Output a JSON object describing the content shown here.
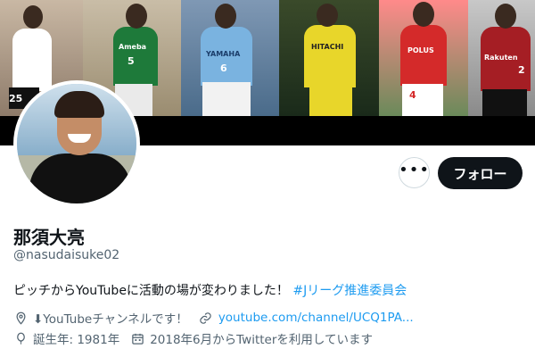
{
  "profile": {
    "display_name": "那須大亮",
    "handle": "@nasudaisuke02",
    "bio_text": "ピッチからYouTubeに活動の場が変わりました！",
    "bio_hashtag": "#Jリーグ推進委員会",
    "location": "⬇YouTubeチャンネルです！",
    "website": "youtube.com/channel/UCQ1PA...",
    "birth": "誕生年: 1981年",
    "joined": "2018年6月からTwitterを利用しています"
  },
  "actions": {
    "more_label": "•••",
    "follow_label": "フォロー"
  },
  "banner": {
    "panels": [
      {
        "shirt_color": "#ffffff",
        "number": "25",
        "logo": ""
      },
      {
        "shirt_color": "#1e7a3a",
        "number": "5",
        "logo": "Ameba"
      },
      {
        "shirt_color": "#7ab3e0",
        "number": "6",
        "logo": "YAMAHA"
      },
      {
        "shirt_color": "#e8d62a",
        "number": "",
        "logo": "HITACHI"
      },
      {
        "shirt_color": "#d42a2a",
        "number": "4",
        "logo": "POLUS"
      },
      {
        "shirt_color": "#a51e24",
        "number": "2",
        "logo": "Rakuten"
      }
    ]
  },
  "colors": {
    "accent": "#1d9bf0",
    "text_primary": "#0f1419",
    "text_secondary": "#536471",
    "follow_bg": "#0f1419"
  },
  "icons": {
    "location": "location-pin-icon",
    "link": "link-icon",
    "birth": "balloon-icon",
    "calendar": "calendar-icon"
  }
}
